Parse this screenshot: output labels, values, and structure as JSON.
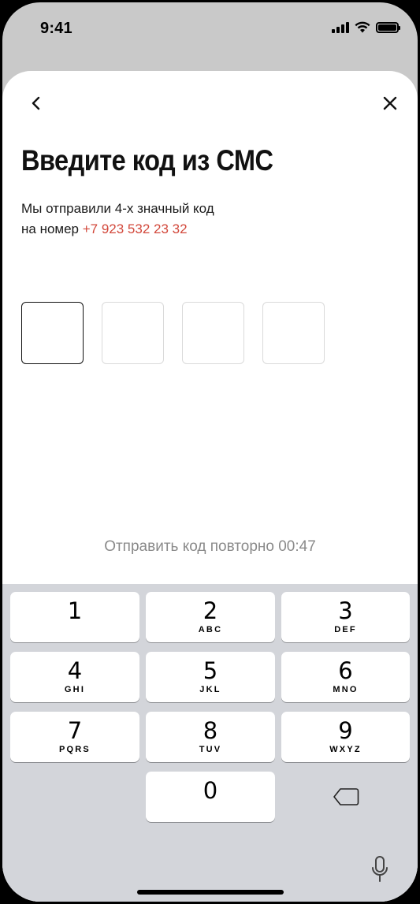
{
  "status_bar": {
    "time": "9:41"
  },
  "header": {
    "back_icon": "chevron-left-icon",
    "close_icon": "close-icon"
  },
  "title": "Введите код из СМС",
  "subtitle": {
    "line1": "Мы отправили 4-х значный код",
    "line2_prefix": "на номер ",
    "phone": "+7 923 532 23 32"
  },
  "code": {
    "length": 4,
    "values": [
      "",
      "",
      "",
      ""
    ],
    "active_index": 0
  },
  "resend": {
    "label": "Отправить код повторно 00:47"
  },
  "colors": {
    "accent": "#d2473a",
    "keyboard_bg": "#d3d5da",
    "sheet_bg": "#ffffff"
  },
  "keyboard": {
    "keys": [
      {
        "num": "1",
        "letters": ""
      },
      {
        "num": "2",
        "letters": "ABC"
      },
      {
        "num": "3",
        "letters": "DEF"
      },
      {
        "num": "4",
        "letters": "GHI"
      },
      {
        "num": "5",
        "letters": "JKL"
      },
      {
        "num": "6",
        "letters": "MNO"
      },
      {
        "num": "7",
        "letters": "PQRS"
      },
      {
        "num": "8",
        "letters": "TUV"
      },
      {
        "num": "9",
        "letters": "WXYZ"
      },
      {
        "num": "0",
        "letters": ""
      }
    ],
    "delete_icon": "backspace-icon",
    "mic_icon": "microphone-icon"
  }
}
